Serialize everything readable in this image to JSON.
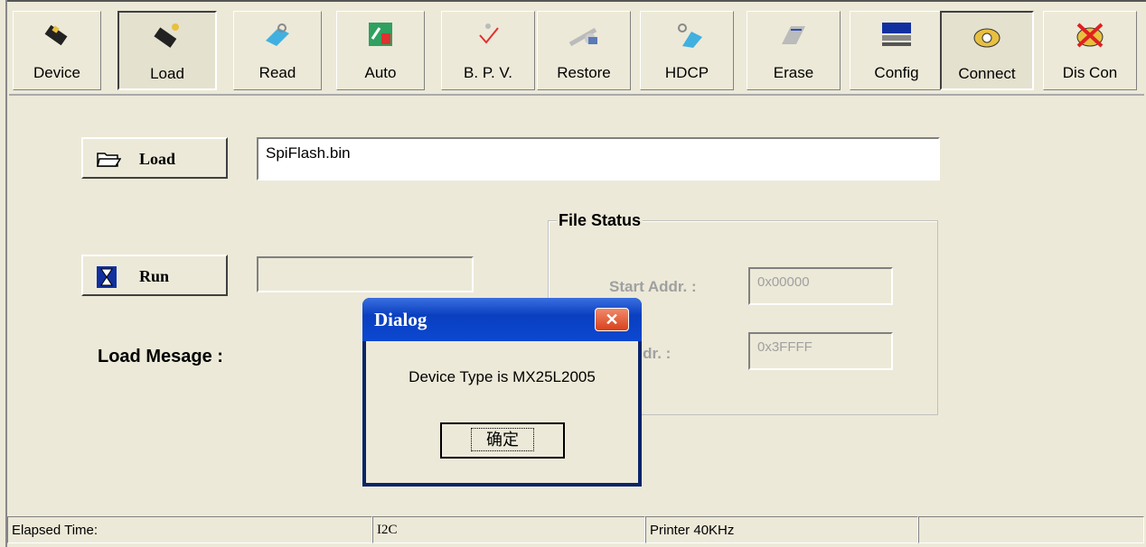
{
  "toolbar": {
    "buttons": [
      {
        "label": "Device",
        "icon": "chip-icon"
      },
      {
        "label": "Load",
        "icon": "chip-load-icon"
      },
      {
        "label": "Read",
        "icon": "read-icon"
      },
      {
        "label": "Auto",
        "icon": "auto-icon"
      },
      {
        "label": "B. P. V.",
        "icon": "checkmark-icon"
      },
      {
        "label": "Restore",
        "icon": "restore-icon"
      },
      {
        "label": "HDCP",
        "icon": "hdcp-icon"
      },
      {
        "label": "Erase",
        "icon": "eraser-icon"
      },
      {
        "label": "Config",
        "icon": "config-icon"
      },
      {
        "label": "Connect",
        "icon": "phone-icon"
      },
      {
        "label": "Dis Con",
        "icon": "disconnect-icon"
      }
    ]
  },
  "main": {
    "load_button": "Load",
    "file_path": "SpiFlash.bin",
    "run_button": "Run",
    "run_field": "",
    "load_message_label": "Load Mesage :",
    "file_status": {
      "title": "File Status",
      "start_label": "Start Addr. :",
      "start_value": "0x00000",
      "end_label": "d Addr. :",
      "end_value": "0x3FFFF"
    }
  },
  "dialog": {
    "title": "Dialog",
    "message": "Device Type is MX25L2005",
    "ok_label": "确定"
  },
  "status_bar": {
    "elapsed": "Elapsed Time:",
    "bus": "I2C",
    "printer": "Printer  40KHz",
    "extra": ""
  }
}
